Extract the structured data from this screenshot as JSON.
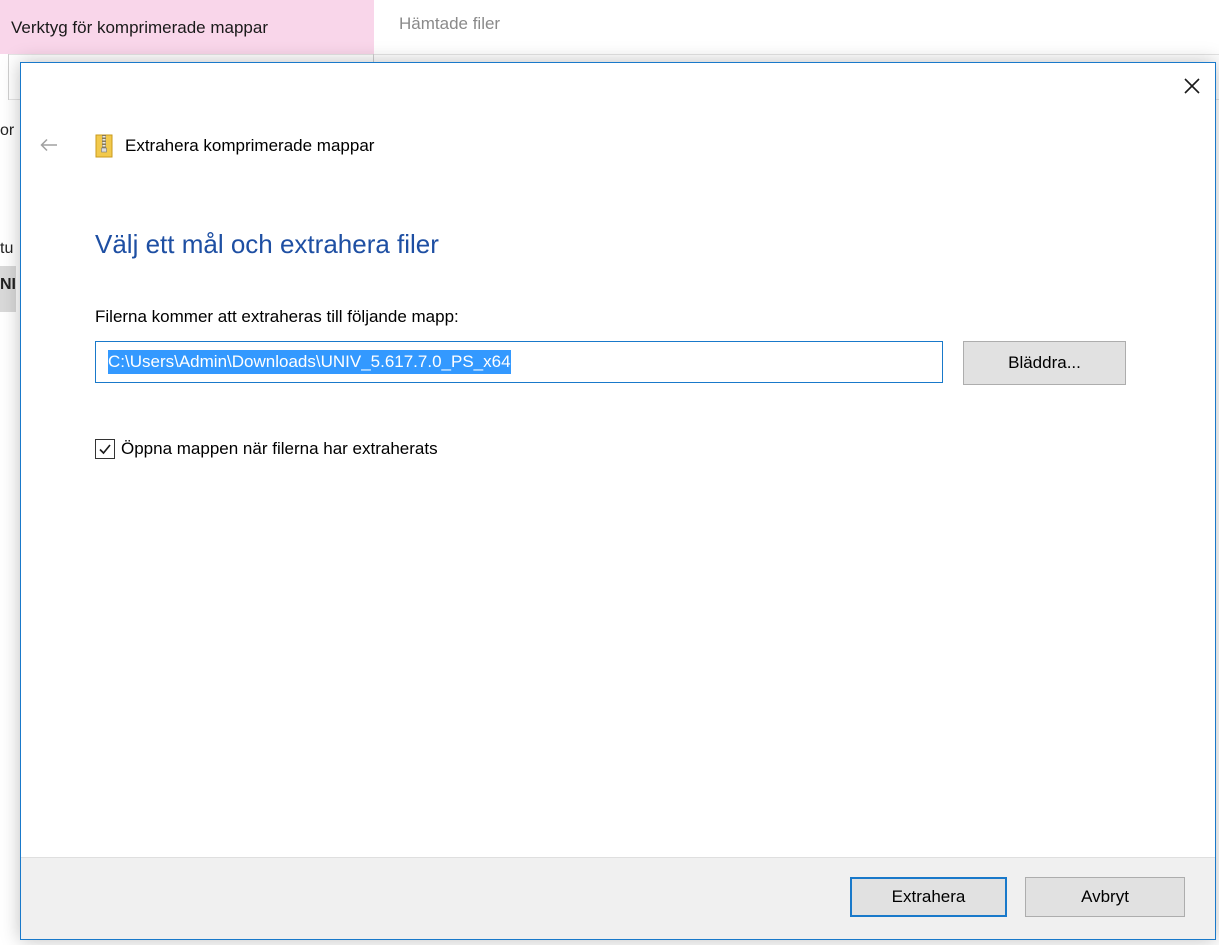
{
  "background": {
    "ribbon_active_tab": "Verktyg för komprimerade mappar",
    "ribbon_inactive_tab": "Hämtade filer",
    "fragments": [
      "or",
      "tu",
      "NI"
    ]
  },
  "dialog": {
    "title": "Extrahera komprimerade mappar",
    "heading": "Välj ett mål och extrahera filer",
    "path_label": "Filerna kommer att extraheras till följande mapp:",
    "path_value": "C:\\Users\\Admin\\Downloads\\UNIV_5.617.7.0_PS_x64",
    "browse_label": "Bläddra...",
    "checkbox_label": "Öppna mappen när filerna har extraherats",
    "checkbox_checked": true,
    "extract_label": "Extrahera",
    "cancel_label": "Avbryt",
    "icons": {
      "close": "close-icon",
      "back": "back-arrow-icon",
      "zip_folder": "zip-folder-icon",
      "checkmark": "checkmark-icon"
    }
  },
  "colors": {
    "accent": "#1979ca",
    "heading": "#1e4fa3",
    "selection": "#3399ff",
    "ribbon_tab": "#f9d6ea"
  }
}
